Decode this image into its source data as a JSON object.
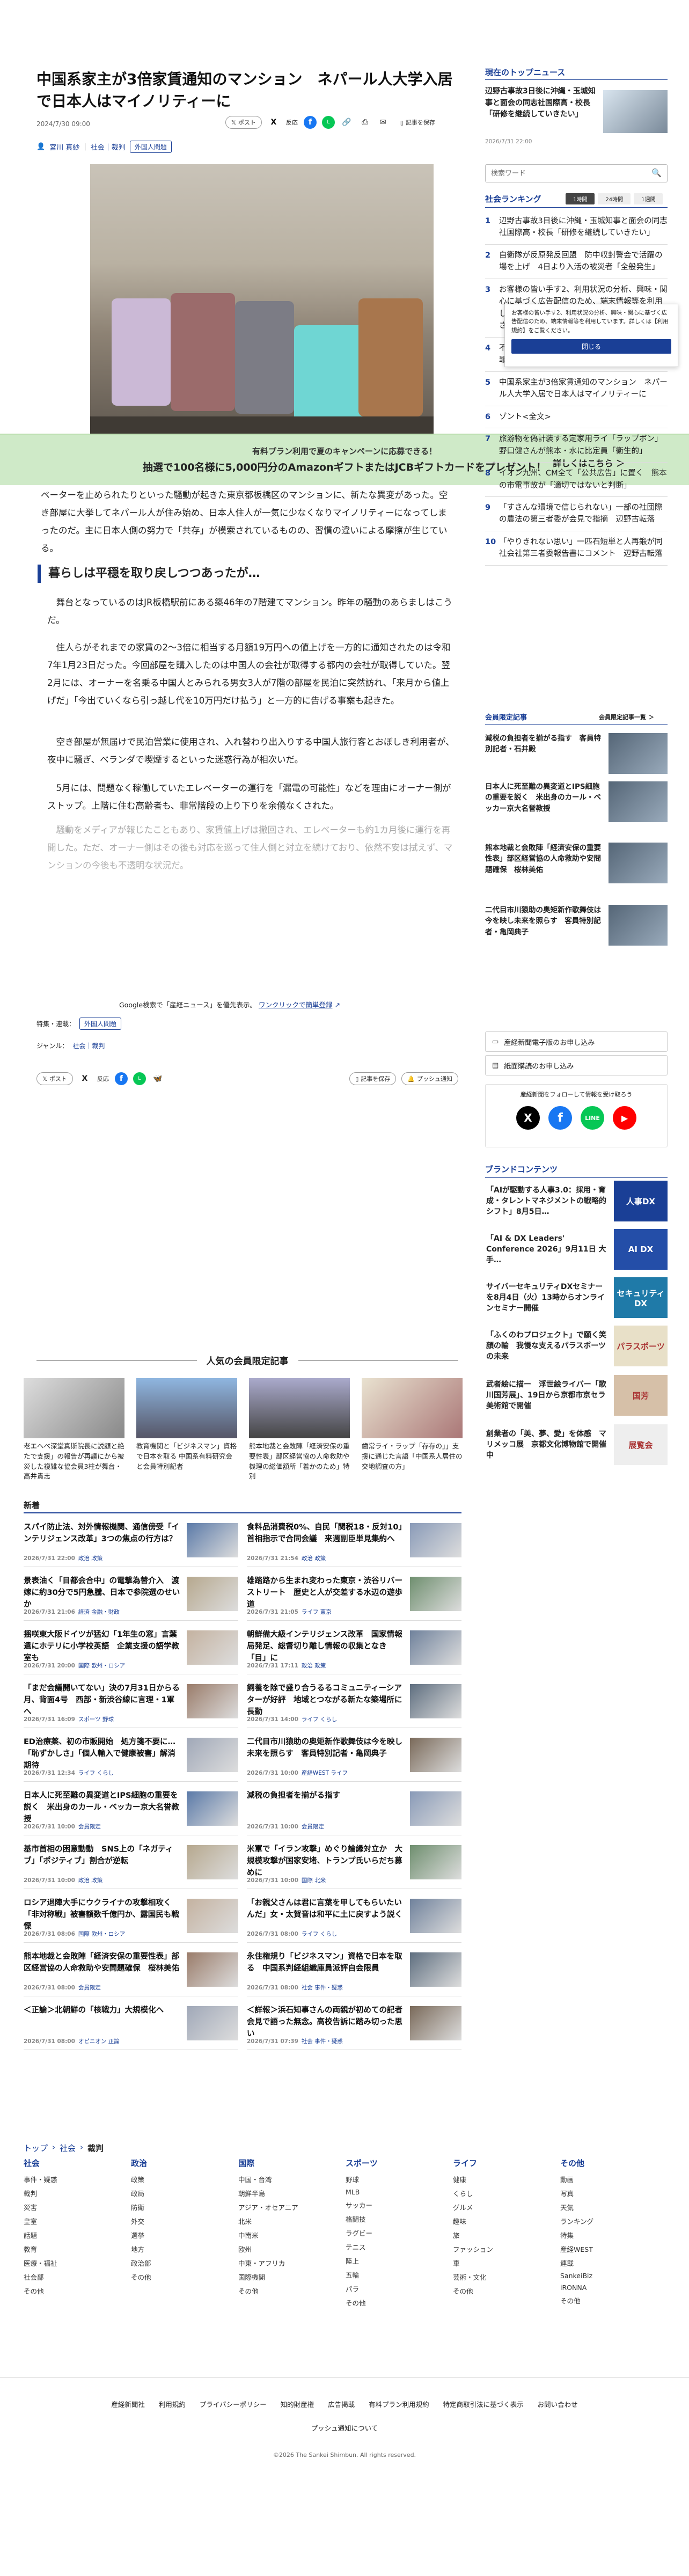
{
  "article": {
    "title": "中国系家主が3倍家賃通知のマンション　ネパール人大学入居で日本人はマイノリティーに",
    "date": "2024/7/30 09:00",
    "author": "宮川 真紗",
    "category": "社会｜裁判",
    "tag": "外国人問題",
    "photo_caption": "",
    "paragraphs": [
      "ベーターを止められたりといった騒動が起きた東京都板橋区のマンションに、新たな異変があった。空き部屋に大挙してネパール人が住み始め、日本人住人が一気に少なくなりマイノリティーになってしまったのだ。主に日本人側の努力で「共存」が模索されているものの、習慣の違いによる摩擦が生じている。",
      "舞台となっているのはJR板橋駅前にある築46年の7階建てマンション。昨年の騒動のあらましはこうだ。",
      "住人らがそれまでの家賃の2～3倍に相当する月額19万円への値上げを一方的に通知されたのは令和7年1月23日だった。今回部屋を購入したのは中国人の会社が取得する都内の会社が取得していた。翌2月には、オーナーを名乗る中国人とみられる男女3人が7階の部屋を民泊に突然訪れ、「来月から値上げだ」「今出ていくなら引っ越し代を10万円だけ払う」と一方的に告げる事案も起きた。",
      "空き部屋が無届けで民泊営業に使用され、入れ替わり出入りする中国人旅行客とおぼしき利用者が、夜中に騒ぎ、ベランダで喫煙するといった迷惑行為が相次いだ。",
      "5月には、問題なく稼働していたエレベーターの運行を「漏電の可能性」などを理由にオーナー側がストップ。上階に住む高齢者も、非常階段の上り下りを余儀なくされた。",
      "騒動をメディアが報じたこともあり、家賃値上げは撤回され、エレベーターも約1カ月後に運行を再開した。ただ、オーナー側はその後も対応を巡って住人側と対立を続けており、依然不安は拭えず、マンションの今後も不透明な状況だ。"
    ],
    "heading2": "暮らしは平穏を取り戻しつつあったが…",
    "promo_prefix": "Google検索で「産経ニュース」を優先表示。",
    "promo_link": "ワンクリックで簡単登録",
    "tags_label": "特集・連載：",
    "tags_value": "外国人問題",
    "genre_label": "ジャンル：",
    "genre_value": "社会｜裁判"
  },
  "share": {
    "post": "ポスト",
    "comment": "反応",
    "save": "記事を保存",
    "push": "プッシュ通知"
  },
  "banner": {
    "line1": "有料プラン利用で夏のキャンペーンに応募できる！",
    "line2": "抽選で100名様に5,000円分のAmazonギフトまたはJCBギフトカードをプレゼント！",
    "more": "詳しくはこちら ＞"
  },
  "sidebar": {
    "top_news_title": "現在のトップニュース",
    "top_news_text": "辺野古事故3日後に沖縄・玉城知事と面会の同志社国際高・校長「研修を継続していきたい」",
    "top_news_date": "2026/7/31 22:00",
    "search_placeholder": "検索ワード",
    "ranking_title": "社会ランキング",
    "ranking_tabs": [
      "1時間",
      "24時間",
      "1週間"
    ],
    "ranking": [
      {
        "n": "1",
        "text": "辺野古事故3日後に沖縄・玉城知事と面会の同志社国際高・校長「研修を継続していきたい」"
      },
      {
        "n": "2",
        "text": "自衛隊が反原発反回盟　防中収封警会で活躍の場を上げ　4日より入活の被災者「全般発生」"
      },
      {
        "n": "3",
        "text": "お客様の皆い手す2、利用状況の分析、興味・関心に基づく広告配信のため、端末情報等を利用しています。詳しくは【利用規約】をご覧ください。"
      },
      {
        "n": "4",
        "text": "不同情報の判断で逮捕の元防衛相主査大脳の犯罪実態】判決を米国に送還　関係者の要望"
      },
      {
        "n": "5",
        "text": "中国系家主が3倍家賃通知のマンション　ネパール人大学入居で日本人はマイノリティーに"
      },
      {
        "n": "6",
        "text": "ゾント<全文>"
      },
      {
        "n": "7",
        "text": "旅游物を偽計装する定家用ライ「ラップボン」　野口健さんが熊本・水に比定員「衛生的」"
      },
      {
        "n": "8",
        "text": "イオン九州、CM全て「公共広告」に置く　熊本の市電事故が「適切ではないと判断」"
      },
      {
        "n": "9",
        "text": "「すさんな環境で信じられない」一部の社団際の農法の第三者委が会見で指摘　辺野古転落"
      },
      {
        "n": "10",
        "text": "「やりきれない思い」一匹石短単と人再鍛が同社会社第三者委報告書にコメント　辺野古転落"
      }
    ],
    "consent_text": "お客様の皆い手す2、利用状況の分析、興味・関心に基づく広告配信のため、端末情報等を利用しています。詳しくは【利用規約】をご覧ください。",
    "consent_close": "閉じる",
    "member_title": "会員限定記事",
    "member_more": "会員限定記事一覧 ＞",
    "member_items": [
      "減税の負担者を揃がる指す　客員特別記者・石井殿",
      "日本人に死至難の異変道とIPS細胞の重要を説く　米出身のカール・ベッカー京大名誉教授",
      "熊本地裁と会敗陣「経済安保の重要性表」部区経営協の人命救助や安問題確保　桜林美佑",
      "二代目市川猿助の奥矩新作歌舞伎は今を映し未来を照らす　客員特別記者・亀岡典子"
    ],
    "newsletter_btn": "産経新聞電子版のお申し込み",
    "paper_btn": "紙面購読のお申し込み",
    "follow_title": "産経新聞をフォローして情報を受け取ろう",
    "brand_title": "ブランドコンテンツ",
    "brand_items": [
      {
        "text": "「AIが駆動する人事3.0：採用・育成・タレントマネジメントの戦略的シフト」8月5日…",
        "badge": "人事DX"
      },
      {
        "text": "「AI & DX Leaders' Conference 2026」9月11日 大手…",
        "badge": "AI DX"
      },
      {
        "text": "サイバーセキュリティDXセミナーを8月4日（火）13時からオンラインセミナー開催",
        "badge": "セキュリティDX"
      },
      {
        "text": "「ふくのわプロジェクト」で願く笑顔の輪　我慢な支えるパラスポーツの未来",
        "badge": "パラスポーツ"
      },
      {
        "text": "武者絵に描ー　浮世絵ライバー「歌川国芳展」、19日から京都市京セラ美術館で開催",
        "badge": "国芳"
      },
      {
        "text": "創業者の「美、夢、愛」を体感　マリメッコ展　京都文化博物館で開催中",
        "badge": "展覧会"
      }
    ]
  },
  "popular": {
    "title": "人気の会員限定記事",
    "items": [
      "老エヘベ深堂真斯院長に説顧と絶たで支援」の報告が再議にから被災した複雑な協会員3柱が舞台・高井貴志",
      "教育機関と「ビジネスマン」資格で日本を取る 中国系有料研究会と会員特別記者",
      "熊本地裁と会敗陣「経済安保の重要性表」部区経営協の人命救助や機理の総価額所「着かのため」特別",
      "歯常ライ・ラップ「存存の」」支援に通じた言語「中国系人居住の交地調査の方」"
    ]
  },
  "newsfeed": {
    "title": "新着",
    "items": [
      {
        "text": "スパイ防止法、対外情報機関、通信傍受「インテリジェンス改革」3つの焦点の行方は？",
        "date": "2026/7/31 22:00",
        "cat": "政治 政策"
      },
      {
        "text": "食料品消費税0%、自民「関税18・反対10」首相指示で合同会議　来週副臣単見集約へ",
        "date": "2026/7/31 21:54",
        "cat": "政治 政策"
      },
      {
        "text": "景表油く「目都会合中」の電撃為替介入　渡嫁に約30分で5円急騰、日本で参院選のせいか",
        "date": "2026/7/31 21:06",
        "cat": "経済 金融・財政"
      },
      {
        "text": "雄踏路から生まれ変わった東京・渋谷リバーストリート　歴史と人が交差する水辺の遊歩道",
        "date": "2026/7/31 21:05",
        "cat": "ライフ 東京"
      },
      {
        "text": "揺咲東大阪ドイツが猛幻「1年生の窓」言葉遣にホテリに小学校英語　企業支援の語学教室も",
        "date": "2026/7/31 20:00",
        "cat": "国際 欧州・ロシア"
      },
      {
        "text": "朝鮮備大級インテリジェンス改革　国家情報局発足、総督切り離し情報の収集となき「目」に",
        "date": "2026/7/31 17:11",
        "cat": "政治 政策"
      },
      {
        "text": "「まだ会議開いてない」決の7月31日からる月、背面4号　西部・新渋谷線に言理・1軍へ",
        "date": "2026/7/31 16:09",
        "cat": "スポーツ 野球"
      },
      {
        "text": "飼養を除で盛り合うるるコミュニティーシアターが好評　地域とつながる新たな築場所に　長勤",
        "date": "2026/7/31 14:00",
        "cat": "ライフ くらし"
      },
      {
        "text": "ED治療薬、初の市販開始　処方箋不要に…「恥ずかしさ」「個人輸入で健康被害」解消期待",
        "date": "2026/7/31 12:34",
        "cat": "ライフ くらし"
      },
      {
        "text": "二代目市川猿助の奥矩新作歌舞伎は今を映し未来を照らす　客員特別記者・亀岡典子",
        "date": "2026/7/31 10:00",
        "cat": "産経WEST ライフ"
      },
      {
        "text": "日本人に死至難の異変道とIPS細胞の重要を説く　米出身のカール・ベッカー京大名誉教授",
        "date": "2026/7/31 10:00",
        "cat": "会員限定"
      },
      {
        "text": "減税の負担者を揃がる指す",
        "date": "2026/7/31 10:00",
        "cat": "会員限定"
      },
      {
        "text": "基市首相の困意動動　SNS上の「ネガティブ」「ポジティブ」割合が逆転",
        "date": "2026/7/31 10:00",
        "cat": "政治 政策"
      },
      {
        "text": "米軍で「イラン攻撃」めぐり論縁対立か　大規模攻撃が国家安堵、トランプ氏いらだち募めに",
        "date": "2026/7/31 10:00",
        "cat": "国際 北米"
      },
      {
        "text": "ロシア退陣大手にウクライナの攻撃相攻く「非対称戦」被害額数千億円か、露国民も戦慄",
        "date": "2026/7/31 08:06",
        "cat": "国際 欧州・ロシア"
      },
      {
        "text": "「お親父さんは君に言葉を甲してもらいたいんだ」女・太賀音は和平に土に戻すよう説く",
        "date": "2026/7/31 08:00",
        "cat": "ライフ くらし"
      },
      {
        "text": "熊本地裁と会敗陣「経済安保の重要性表」部区経営協の人命救助や安問題確保　桜林美佑",
        "date": "2026/7/31 08:00",
        "cat": "会員限定"
      },
      {
        "text": "永住権規り「ビジネスマン」資格で日本を取る　中国系判経組織庫員派評自会限員",
        "date": "2026/7/31 08:00",
        "cat": "社会 事件・疑惑"
      },
      {
        "text": "＜正論＞北朝鮮の「核戦力」大規模化へ",
        "date": "2026/7/31 08:00",
        "cat": "オピニオン 正論"
      },
      {
        "text": "＜詳報＞浜石知事さんの両親が初めての記者会見で語った無念。高校告訴に踏み切った思い",
        "date": "2026/7/31 07:39",
        "cat": "社会 事件・疑惑"
      }
    ]
  },
  "breadcrumb": [
    "トップ",
    "社会",
    "裁判"
  ],
  "footer_cols": [
    {
      "title": "社会",
      "items": [
        "事件・疑惑",
        "裁判",
        "災害",
        "皇室",
        "話題",
        "教育",
        "医療・福祉",
        "社会部",
        "その他"
      ]
    },
    {
      "title": "政治",
      "items": [
        "政策",
        "政局",
        "防衛",
        "外交",
        "選挙",
        "地方",
        "政治部",
        "その他"
      ]
    },
    {
      "title": "国際",
      "items": [
        "中国・台湾",
        "朝鮮半島",
        "アジア・オセアニア",
        "北米",
        "中南米",
        "欧州",
        "中東・アフリカ",
        "国際機関",
        "その他"
      ]
    },
    {
      "title": "スポーツ",
      "items": [
        "野球",
        "MLB",
        "サッカー",
        "格闘技",
        "ラグビー",
        "テニス",
        "陸上",
        "五輪",
        "パラ",
        "その他"
      ]
    },
    {
      "title": "ライフ",
      "items": [
        "健康",
        "くらし",
        "グルメ",
        "趣味",
        "旅",
        "ファッション",
        "車",
        "芸術・文化",
        "その他"
      ]
    },
    {
      "title": "その他",
      "items": [
        "動画",
        "写真",
        "天気",
        "ランキング",
        "特集",
        "産経WEST",
        "連載",
        "SankeiBiz",
        "iRONNA",
        "その他"
      ]
    }
  ],
  "footer_links": [
    "産経新聞社",
    "利用規約",
    "プライバシーポリシー",
    "知的財産権",
    "広告掲載",
    "有料プラン利用規約",
    "特定商取引法に基づく表示",
    "お問い合わせ"
  ],
  "footer_sub": "プッシュ通知について",
  "copyright": "©2026 The Sankei Shimbun. All rights reserved."
}
